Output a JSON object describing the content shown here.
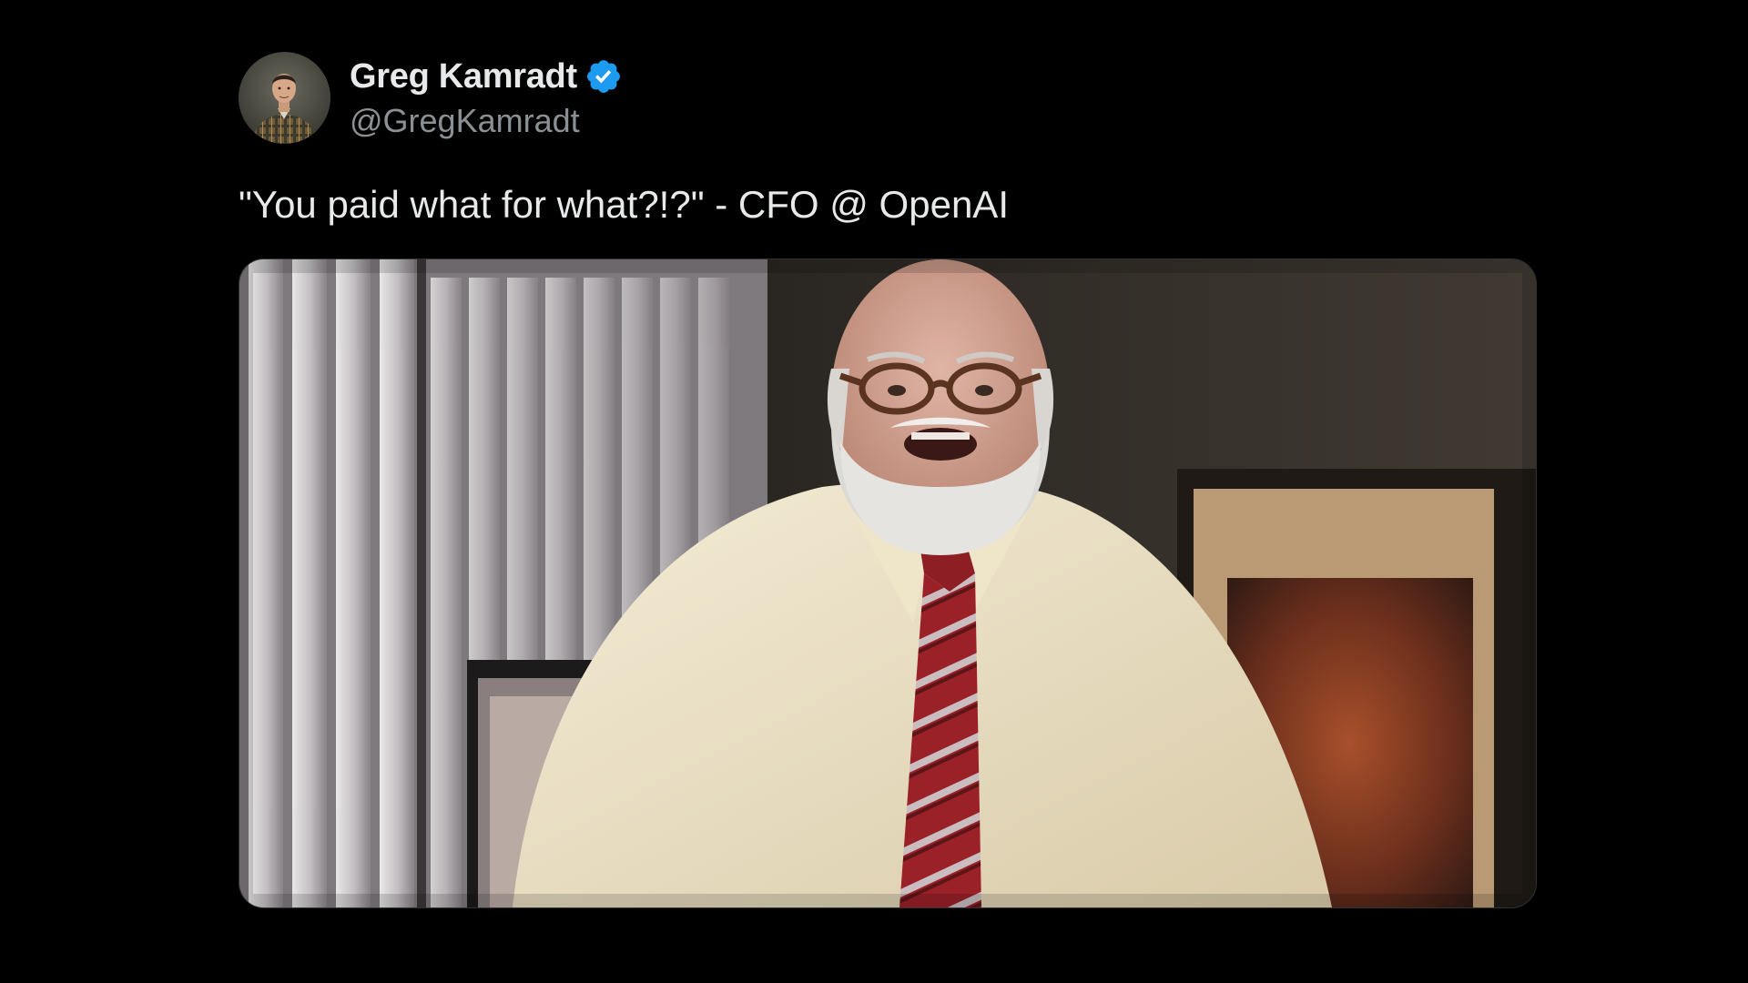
{
  "author": {
    "display_name": "Greg Kamradt",
    "handle": "@GregKamradt",
    "verified": true,
    "verified_badge_color": "#1d9bf0",
    "avatar_icon": "avatar-photo"
  },
  "tweet": {
    "text": "\"You paid what for what?!?\" - CFO @ OpenAI"
  },
  "media": {
    "type": "image",
    "subject": "man-in-office-photo"
  },
  "colors": {
    "background": "#000000",
    "text_primary": "#e7e9ea",
    "text_secondary": "#8b9095"
  }
}
